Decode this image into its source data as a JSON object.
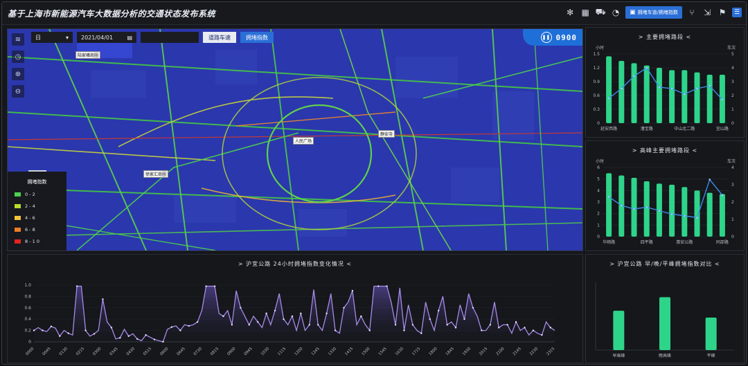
{
  "header": {
    "title": "基于上海市新能源汽车大数据分析的交通状态发布系统",
    "tools": [
      "snowflake-icon",
      "chart-icon",
      "car-icon",
      "gauge-icon"
    ],
    "primary_button": "拥堵车道/拥堵指数",
    "tools_right": [
      "branch-icon",
      "share-icon",
      "flag-icon"
    ]
  },
  "map": {
    "period_select": "日",
    "date_value": "2021/04/01",
    "road_button": "道路车速",
    "active_button": "拥堵指数",
    "time": "0900",
    "legend": {
      "title": "拥堵指数",
      "items": [
        {
          "label": "0 - 2",
          "color": "#4bd14e"
        },
        {
          "label": "2 - 4",
          "color": "#b8dc2c"
        },
        {
          "label": "4 - 6",
          "color": "#f2c33a"
        },
        {
          "label": "6 - 8",
          "color": "#f07d24"
        },
        {
          "label": "8 - 1 0",
          "color": "#e8231f"
        }
      ]
    },
    "places": [
      "陆家嘴商圈",
      "人民广场",
      "静安寺",
      "徐家汇商圈"
    ]
  },
  "chart1": {
    "title": "> 主要拥堵路段 <",
    "y_left_unit": "小时",
    "y_right_unit": "车次",
    "left_ticks": [
      "1.5",
      "1.2",
      "0.9",
      "0.6",
      "0.3",
      "0"
    ],
    "right_ticks": [
      "5",
      "4",
      "3",
      "2",
      "1",
      "0"
    ],
    "categories": [
      "延安西路",
      "",
      "漕宝路",
      "",
      "中山北二路",
      "",
      "宜山路"
    ],
    "colors": {
      "bar": "#2ed48a",
      "line": "#3b8ee8"
    }
  },
  "chart2": {
    "title": "> 高峰主要拥堵路段 <",
    "y_left_unit": "小时",
    "y_right_unit": "车次",
    "left_ticks": [
      "6",
      "5",
      "4",
      "3",
      "2",
      "1",
      "0"
    ],
    "right_ticks": [
      "4",
      "3",
      "2",
      "1",
      "0"
    ],
    "categories": [
      "华翔路",
      "",
      "四平路",
      "",
      "惠安公路",
      "",
      "同邵路"
    ],
    "colors": {
      "bar": "#2ed48a",
      "line": "#3b8ee8"
    }
  },
  "chart3": {
    "title": "> 沪宜公路 24小时拥堵指数变化情况 <",
    "y_ticks": [
      "1.0",
      "0.8",
      "0.6",
      "0.4",
      "0.2",
      "0"
    ],
    "x_ticks": [
      "0000",
      "0045",
      "0130",
      "0215",
      "0300",
      "0345",
      "0430",
      "0515",
      "0600",
      "0645",
      "0730",
      "0815",
      "0900",
      "0945",
      "1030",
      "1115",
      "1200",
      "1245",
      "1330",
      "1415",
      "1500",
      "1545",
      "1630",
      "1715",
      "1800",
      "1845",
      "1930",
      "2015",
      "2100",
      "2145",
      "2230",
      "2315"
    ],
    "colors": {
      "line": "#a98be8",
      "fill": "#3b2f63"
    }
  },
  "chart4": {
    "title": "> 沪宜公路 早/晚/平峰拥堵指数对比 <",
    "categories": [
      "早高峰",
      "晚高峰",
      "平峰"
    ],
    "colors": {
      "bar": "#2ed48a"
    }
  },
  "chart_data": [
    {
      "type": "bar",
      "title": "> 主要拥堵路段 <",
      "ylabel": "小时",
      "categories": [
        "延安西路",
        "",
        "漕宝路",
        "",
        "中山北二路",
        "",
        "宜山路",
        "",
        "",
        ""
      ],
      "series": [
        {
          "type": "bar",
          "values": [
            1.45,
            1.35,
            1.3,
            1.25,
            1.2,
            1.15,
            1.15,
            1.1,
            1.05,
            1.05
          ]
        },
        {
          "type": "line",
          "values": [
            1.8,
            2.5,
            3.4,
            4.0,
            2.6,
            2.5,
            2.1,
            2.5,
            2.7,
            1.7
          ]
        }
      ],
      "ylim_left": [
        0,
        1.5
      ],
      "ylim_right": [
        0,
        5
      ]
    },
    {
      "type": "bar",
      "title": "> 高峰主要拥堵路段 <",
      "ylabel": "小时",
      "categories": [
        "华翔路",
        "",
        "四平路",
        "",
        "惠安公路",
        "",
        "同邵路",
        "",
        "",
        ""
      ],
      "series": [
        {
          "type": "bar",
          "values": [
            5.5,
            5.3,
            5.1,
            4.8,
            4.6,
            4.5,
            4.3,
            4.0,
            3.8,
            3.7
          ]
        },
        {
          "type": "line",
          "values": [
            2.3,
            1.8,
            1.6,
            1.7,
            1.5,
            1.3,
            1.2,
            1.1,
            3.3,
            2.4
          ]
        }
      ],
      "ylim_left": [
        0,
        6
      ],
      "ylim_right": [
        0,
        4
      ]
    },
    {
      "type": "area",
      "title": "> 沪宜公路 24小时拥堵指数变化情况 <",
      "ylim": [
        0,
        1.0
      ],
      "values": [
        0.2,
        0.25,
        0.2,
        0.18,
        0.27,
        0.24,
        0.1,
        0.2,
        0.15,
        0.12,
        0.98,
        0.98,
        0.2,
        0.1,
        0.14,
        0.2,
        0.75,
        0.35,
        0.25,
        0.05,
        0.07,
        0.22,
        0.1,
        0.14,
        0.05,
        0.02,
        0.12,
        0.08,
        0.04,
        0.02,
        0.0,
        0.22,
        0.26,
        0.28,
        0.2,
        0.3,
        0.28,
        0.3,
        0.35,
        0.55,
        0.98,
        0.98,
        0.98,
        0.5,
        0.45,
        0.55,
        0.3,
        0.9,
        0.6,
        0.45,
        0.3,
        0.45,
        0.35,
        0.25,
        0.5,
        0.3,
        0.55,
        0.85,
        0.4,
        0.3,
        0.45,
        0.2,
        0.5,
        0.2,
        0.3,
        0.92,
        0.3,
        0.2,
        0.5,
        0.85,
        0.2,
        0.15,
        0.6,
        0.7,
        0.9,
        0.3,
        0.45,
        0.3,
        0.2,
        0.98,
        0.98,
        0.98,
        0.98,
        0.7,
        0.3,
        0.95,
        0.2,
        0.65,
        0.3,
        0.2,
        0.15,
        0.7,
        0.4,
        0.2,
        0.55,
        0.8,
        0.3,
        0.35,
        0.25,
        0.65,
        0.4,
        0.85,
        0.6,
        0.45,
        0.2,
        0.2,
        0.3,
        0.7,
        0.25,
        0.3,
        0.3,
        0.15,
        0.35,
        0.2,
        0.25,
        0.12,
        0.2,
        0.15,
        0.12,
        0.35,
        0.25,
        0.2
      ]
    },
    {
      "type": "bar",
      "title": "> 沪宜公路 早/晚/平峰拥堵指数对比 <",
      "categories": [
        "早高峰",
        "晚高峰",
        "平峰"
      ],
      "values": [
        0.58,
        0.78,
        0.48
      ],
      "ylim": [
        0,
        1.0
      ]
    }
  ]
}
